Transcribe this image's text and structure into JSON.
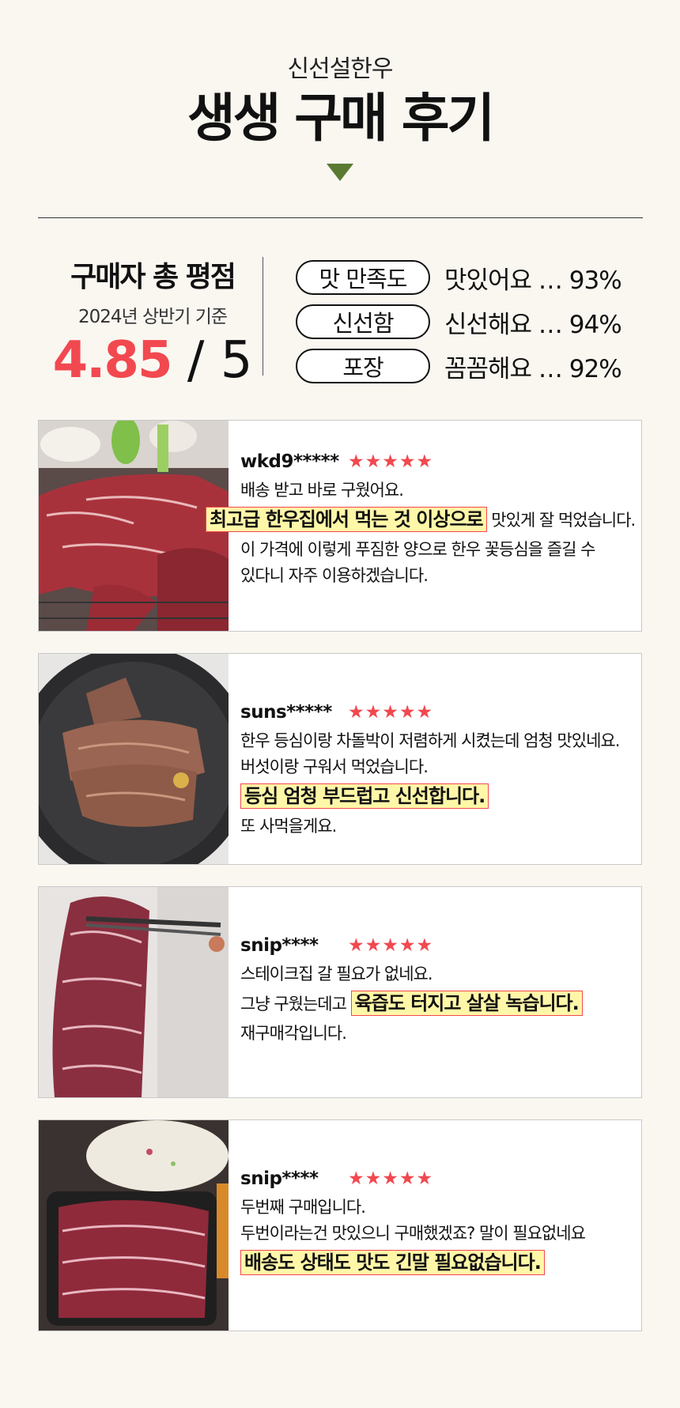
{
  "header": {
    "brand": "신선설한우",
    "title": "생생 구매 후기"
  },
  "summary": {
    "title": "구매자 총 평점",
    "basis": "2024년 상반기 기준",
    "score": "4.85",
    "score_sep": " / 5",
    "ratings": [
      {
        "label": "맛 만족도",
        "text": "맛있어요 … 93%"
      },
      {
        "label": "신선함",
        "text": "신선해요 … 94%"
      },
      {
        "label": "포장",
        "text": "꼼꼼해요 … 92%"
      }
    ]
  },
  "colors": {
    "accent": "#f2484f",
    "arrow": "#5a7a33",
    "highlight": "#fff7a8",
    "background": "#faf7f1"
  },
  "reviews": [
    {
      "user": "wkd9*****",
      "stars": "★★★★★",
      "photo_icon": "grilled-beef-photo",
      "lines": [
        {
          "t": "배송 받고 바로 구웠어요."
        },
        {
          "hl": "최고급 한우집에서 먹는 것 이상으로",
          "t": " 맛있게 잘 먹었습니다."
        },
        {
          "t": "이 가격에 이렇게 푸짐한 양으로 한우 꽃등심을 즐길 수"
        },
        {
          "t": "있다니 자주 이용하겠습니다."
        }
      ]
    },
    {
      "user": "suns*****",
      "stars": "★★★★★",
      "photo_icon": "pan-beef-photo",
      "lines": [
        {
          "t": "한우 등심이랑 차돌박이 저렴하게 시켰는데 엄청 맛있네요."
        },
        {
          "t": "버섯이랑 구워서 먹었습니다."
        },
        {
          "hl": "등심 엄청 부드럽고 신선합니다."
        },
        {
          "t": "또 사먹을게요."
        }
      ]
    },
    {
      "user": "snip****",
      "stars": "★★★★★",
      "photo_icon": "steak-tongs-photo",
      "lines": [
        {
          "t": "스테이크집 갈 필요가 없네요."
        },
        {
          "t": "그냥 구웠는데고 ",
          "hl": "육즙도 터지고 살살 녹습니다."
        },
        {
          "t": "재구매각입니다."
        }
      ]
    },
    {
      "user": "snip****",
      "stars": "★★★★★",
      "photo_icon": "raw-beef-tray-photo",
      "lines": [
        {
          "t": "두번째 구매입니다."
        },
        {
          "t": "두번이라는건 맛있으니 구매했겠죠? 말이 필요없네요"
        },
        {
          "hl": "배송도 상태도 맛도 긴말 필요없습니다."
        }
      ]
    }
  ]
}
